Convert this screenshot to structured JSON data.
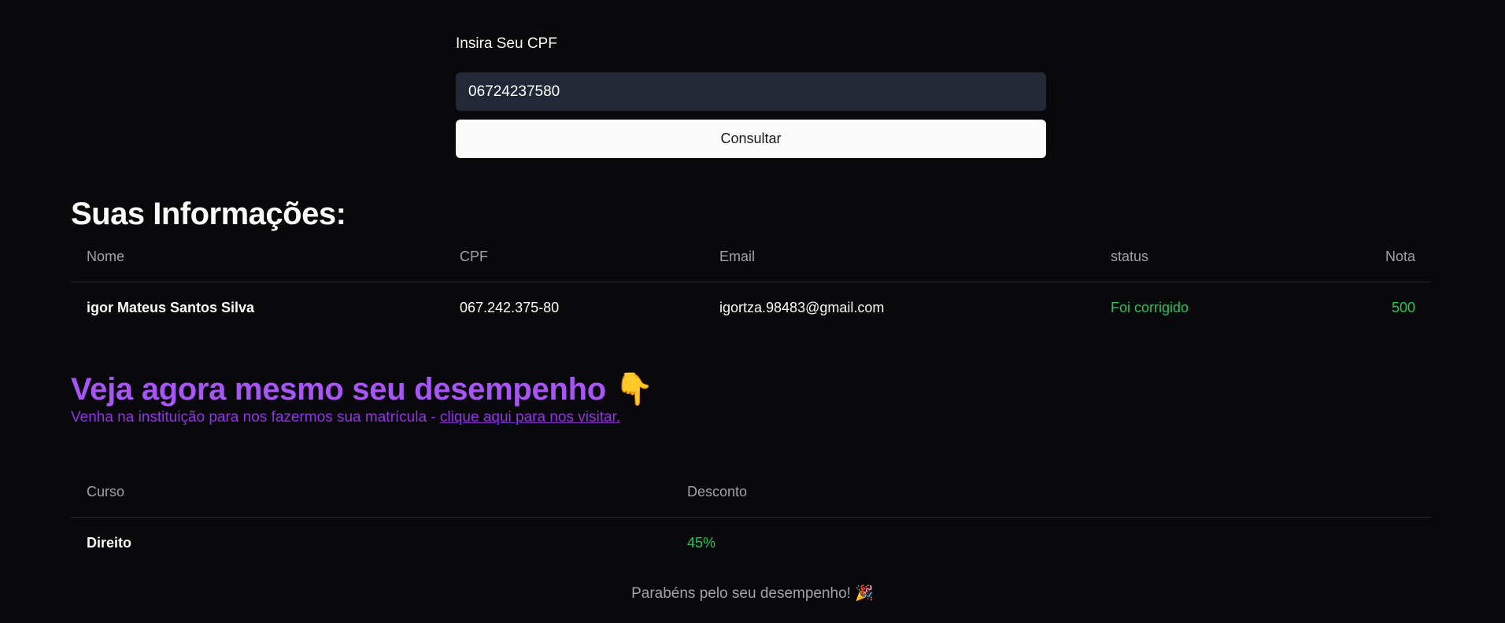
{
  "form": {
    "label": "Insira Seu CPF",
    "cpf_value": "06724237580",
    "button_label": "Consultar"
  },
  "info": {
    "title": "Suas Informações:",
    "columns": {
      "name": "Nome",
      "cpf": "CPF",
      "email": "Email",
      "status": "status",
      "score": "Nota"
    },
    "row": {
      "name": "igor Mateus Santos Silva",
      "cpf": "067.242.375-80",
      "email": "igortza.98483@gmail.com",
      "status": "Foi corrigido",
      "score": "500"
    }
  },
  "performance": {
    "title": "Veja agora mesmo seu desempenho 👇",
    "subtitle": "Venha na instituição para nos fazermos sua matrícula - ",
    "link_text": "clique aqui para nos visitar."
  },
  "courses": {
    "columns": {
      "course": "Curso",
      "discount": "Desconto"
    },
    "row": {
      "course": "Direito",
      "discount": "45%"
    }
  },
  "footer": {
    "message": "Parabéns pelo seu desempenho! 🎉"
  },
  "colors": {
    "background": "#09090b",
    "input_bg": "#222835",
    "accent_purple": "#a855f7",
    "success_green": "#22c55e"
  }
}
